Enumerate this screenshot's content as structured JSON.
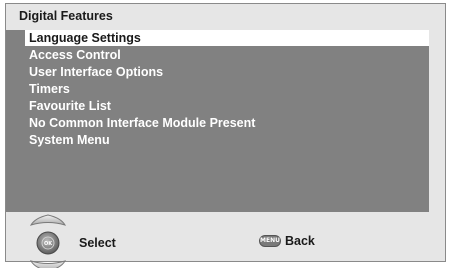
{
  "title": "Digital Features",
  "menu": {
    "items": [
      {
        "label": "Language Settings",
        "selected": true
      },
      {
        "label": "Access Control",
        "selected": false
      },
      {
        "label": "User Interface Options",
        "selected": false
      },
      {
        "label": "Timers",
        "selected": false
      },
      {
        "label": "Favourite List",
        "selected": false
      },
      {
        "label": "No Common Interface Module Present",
        "selected": false
      },
      {
        "label": "System Menu",
        "selected": false
      }
    ]
  },
  "footer": {
    "ok_glyph": "OK",
    "select_label": "Select",
    "menu_glyph": "MENU",
    "back_label": "Back"
  },
  "icons": {
    "up": "arrow-up-icon",
    "ok": "ok-button-icon",
    "down": "arrow-down-icon",
    "menu": "menu-button-icon"
  },
  "colors": {
    "background": "#e6e6e6",
    "panel": "#818181",
    "highlight": "#ffffff",
    "text_on_panel": "#ffffff",
    "text_dark": "#1a1a1a"
  }
}
